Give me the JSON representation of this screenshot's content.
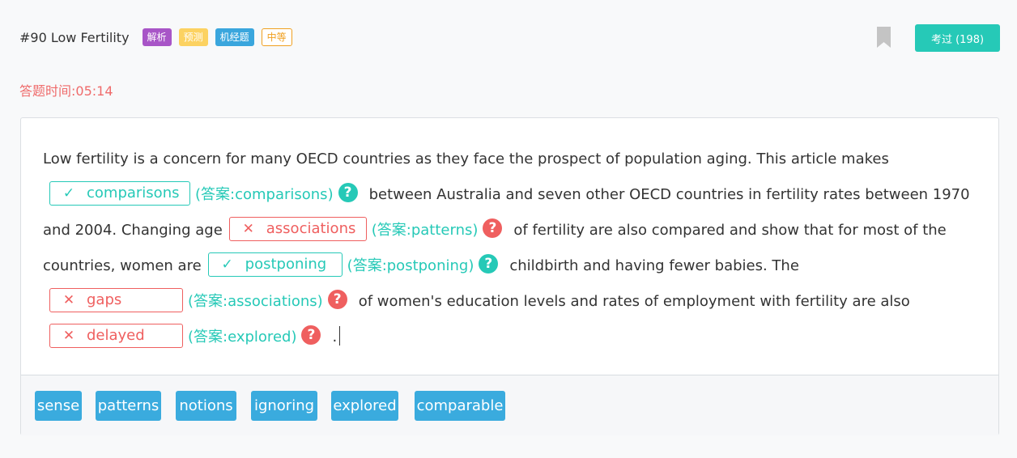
{
  "header": {
    "title": "#90 Low Fertility",
    "tags": [
      "解析",
      "预测",
      "机经题",
      "中等"
    ],
    "tested_label": "考过 (198)"
  },
  "timer": {
    "label": "答题时间:",
    "value": "05:14"
  },
  "passage": {
    "t0": "Low fertility is a concern for many OECD countries as they face the prospect of population aging. This article makes",
    "t1": "between Australia and seven other OECD countries in fertility rates between 1970",
    "t2": "and 2004. Changing age",
    "t3": "of fertility are also compared and show that for most of the",
    "t4": "countries, women are",
    "t5": "childbirth and having fewer babies. The",
    "t6": "of women's education levels and rates of employment with fertility are also",
    "t7": "."
  },
  "blanks": [
    {
      "user": "comparisons",
      "answer": "(答案:comparisons)",
      "status": "correct",
      "mark": "✓"
    },
    {
      "user": "associations",
      "answer": "(答案:patterns)",
      "status": "wrong",
      "mark": "✕"
    },
    {
      "user": "postponing",
      "answer": "(答案:postponing)",
      "status": "correct",
      "mark": "✓"
    },
    {
      "user": "gaps",
      "answer": "(答案:associations)",
      "status": "wrong",
      "mark": "✕"
    },
    {
      "user": "delayed",
      "answer": "(答案:explored)",
      "status": "wrong",
      "mark": "✕"
    }
  ],
  "help_icon": "?",
  "word_bank": [
    "sense",
    "patterns",
    "notions",
    "ignoring",
    "explored",
    "comparable"
  ],
  "colors": {
    "correct": "#26c9b7",
    "wrong": "#ef5f5f",
    "word_chip": "#3aabde",
    "timer": "#ef6b6b"
  }
}
